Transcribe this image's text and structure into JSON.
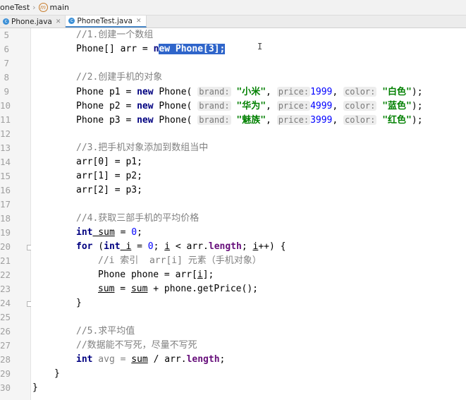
{
  "breadcrumb": {
    "project": "oneTest",
    "method": "main"
  },
  "tabs": [
    {
      "label": "Phone.java",
      "active": false
    },
    {
      "label": "PhoneTest.java",
      "active": true
    }
  ],
  "line_numbers": [
    "5",
    "6",
    "7",
    "8",
    "9",
    "10",
    "11",
    "12",
    "13",
    "14",
    "15",
    "16",
    "17",
    "18",
    "19",
    "20",
    "21",
    "22",
    "23",
    "24",
    "25",
    "26",
    "27",
    "28",
    "29",
    "30"
  ],
  "code": {
    "c1": "//1.创建一个数组",
    "l6a": "Phone[] arr = ",
    "l6sel_a": "n",
    "l6sel_b": "ew Phone[3];",
    "c2": "//2.创建手机的对象",
    "p1_head": "Phone p1 = ",
    "p2_head": "Phone p2 = ",
    "p3_head": "Phone p3 = ",
    "kw_new": "new",
    "ctor": " Phone( ",
    "hint_brand": "brand:",
    "hint_price": "price:",
    "hint_color": "color:",
    "p1_brand": "\"小米\"",
    "p2_brand": "\"华为\"",
    "p3_brand": "\"魅族\"",
    "p1_price": "1999",
    "p2_price": "4999",
    "p3_price": "3999",
    "p1_color": "\"白色\"",
    "p2_color": "\"蓝色\"",
    "p3_color": "\"红色\"",
    "comma": ", ",
    "end": ");",
    "c3": "//3.把手机对象添加到数组当中",
    "a0": "arr[0] = p1;",
    "a1": "arr[1] = p2;",
    "a2": "arr[2] = p3;",
    "c4": "//4.获取三部手机的平均价格",
    "kw_int": "int",
    "sum_decl_name": " sum",
    "sum_decl_rest": " = ",
    "sum_zero": "0",
    "semi": ";",
    "kw_for": "for",
    "for_open": " (",
    "for_i": " i",
    "for_mid1": " = ",
    "for_zero": "0",
    "for_mid2": "; ",
    "for_i2": "i",
    "for_mid3": " < arr.",
    "length": "length",
    "for_mid4": "; ",
    "for_i3": "i",
    "for_end": "++) {",
    "c_inner": "//i 索引  arr[i] 元素（手机对象）",
    "phone_line_a": "Phone phone = arr[",
    "phone_line_i": "i",
    "phone_line_b": "];",
    "sum_line_a": "sum",
    "sum_line_b": " = ",
    "sum_line_c": "sum",
    "sum_line_d": " + phone.getPrice();",
    "close_brace": "}",
    "c5": "//5.求平均值",
    "c6": "//数据能不写死，尽量不写死",
    "avg_a": " avg = ",
    "avg_sum": "sum",
    "avg_b": " / arr.",
    "avg_c": ";",
    "close_main": "}",
    "close_class": "}"
  },
  "cursor": "I"
}
